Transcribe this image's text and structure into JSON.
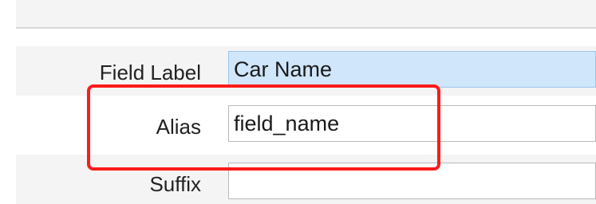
{
  "form": {
    "fields": [
      {
        "label": "Field Label",
        "value": "Car Name"
      },
      {
        "label": "Alias",
        "value": "field_name"
      },
      {
        "label": "Suffix",
        "value": ""
      }
    ]
  },
  "annotation": {
    "color": "#ff1a1a",
    "target": "Alias"
  },
  "colors": {
    "selected_field_bg": "#cfe6fb",
    "row_alt_bg": "#f4f4f4"
  }
}
